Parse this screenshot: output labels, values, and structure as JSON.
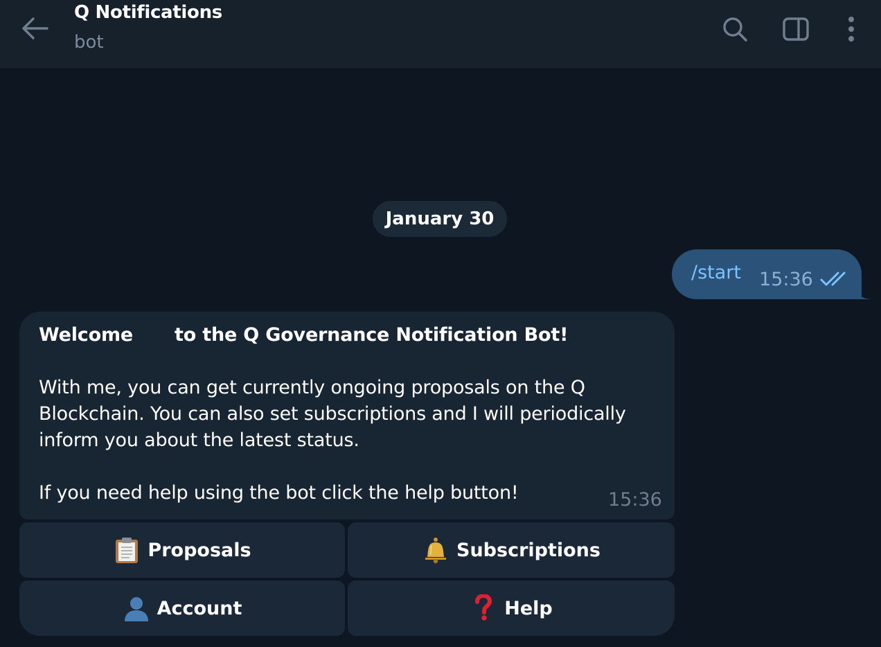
{
  "header": {
    "title": "Q Notifications",
    "subtitle": "bot",
    "icons": [
      "back-arrow-icon",
      "search-icon",
      "sidebar-toggle-icon",
      "more-vertical-icon"
    ]
  },
  "date_separator": "January 30",
  "outgoing_message": {
    "text": "/start",
    "time": "15:36",
    "status_icon": "double-check-icon"
  },
  "incoming_message": {
    "welcome_prefix": "Welcome",
    "welcome_suffix": "to the Q Governance Notification Bot!",
    "body_line_1": "With me, you can get currently ongoing proposals on the Q",
    "body_line_2": "Blockchain. You can also set subscriptions and I will periodically",
    "body_line_3": "inform you about the latest status.",
    "body_line_4": "If you need help using the bot click the help button!",
    "time": "15:36"
  },
  "inline_keyboard": {
    "proposals": {
      "label": "Proposals",
      "icon": "clipboard-icon"
    },
    "subscriptions": {
      "label": "Subscriptions",
      "icon": "bell-icon"
    },
    "account": {
      "label": "Account",
      "icon": "user-silhouette-icon"
    },
    "help": {
      "label": "Help",
      "icon": "question-mark-icon"
    }
  },
  "colors": {
    "background": "#0e1621",
    "header": "#17212b",
    "outgoing_bubble": "#2b5278",
    "incoming_bubble": "#182533",
    "keyboard_button": "#1a2837",
    "link": "#7cc4ff",
    "muted_text": "#7b8b9c"
  }
}
